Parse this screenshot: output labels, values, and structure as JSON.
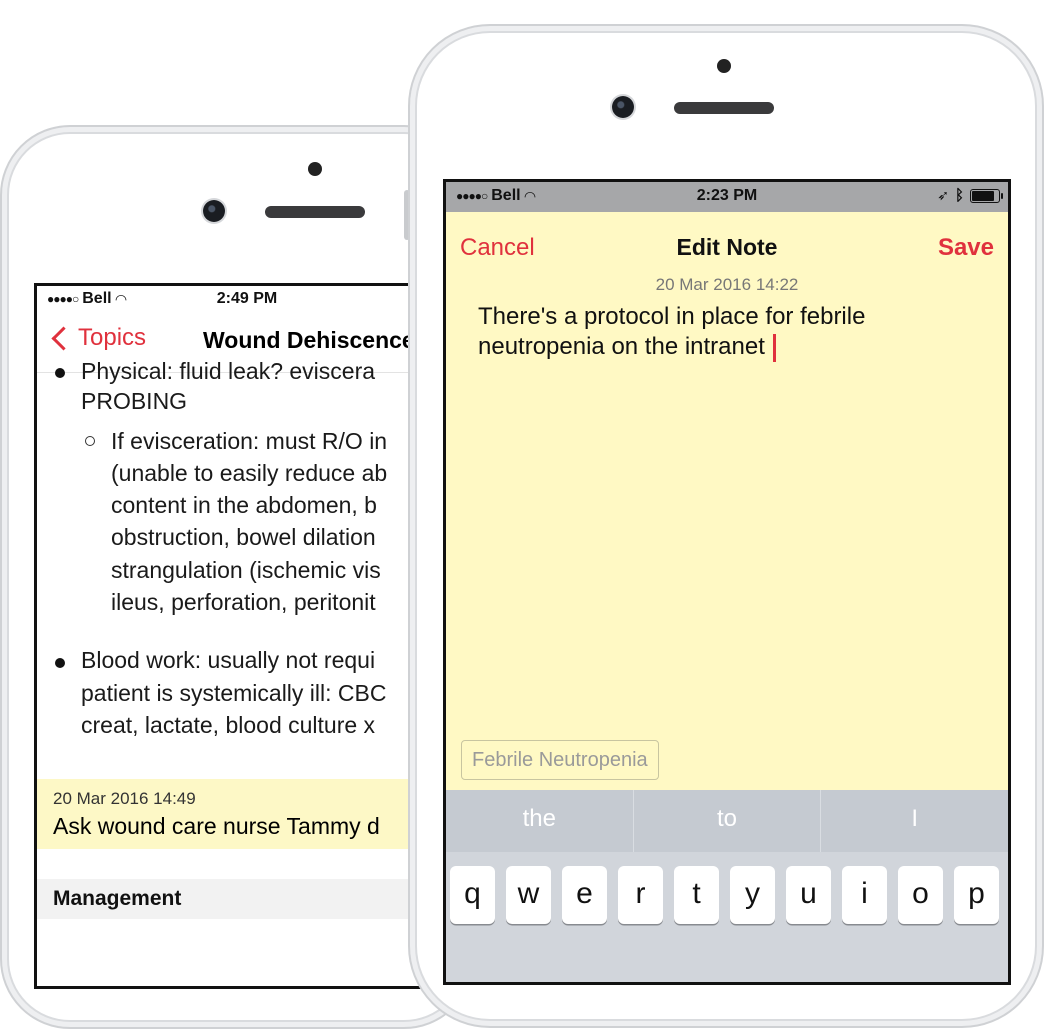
{
  "back_phone": {
    "status": {
      "carrier": "Bell",
      "time": "2:49 PM"
    },
    "nav": {
      "back_label": "Topics",
      "title": "Wound Dehiscence"
    },
    "content_lines": [
      "Physical: fluid leak? eviscera",
      "PROBING",
      "If evisceration: must R/O in",
      "(unable to easily reduce ab",
      "content in the abdomen, b",
      "obstruction, bowel dilation",
      "strangulation (ischemic vis",
      "ileus, perforation, peritonit",
      "Blood work: usually not requi",
      "patient is systemically ill: CBC",
      "creat, lactate, blood culture x"
    ],
    "note": {
      "date": "20 Mar 2016 14:49",
      "text": "Ask wound care nurse Tammy d"
    },
    "section": "Management"
  },
  "front_phone": {
    "status": {
      "carrier": "Bell",
      "time": "2:23 PM"
    },
    "nav": {
      "cancel": "Cancel",
      "title": "Edit Note",
      "save": "Save"
    },
    "note": {
      "date": "20 Mar 2016 14:22",
      "line1": "There's a protocol in place for febrile",
      "line2": "neutropenia on the intranet"
    },
    "tag": "Febrile Neutropenia",
    "keyboard": {
      "suggestions": [
        "the",
        "to",
        "I"
      ],
      "row1": [
        "q",
        "w",
        "e",
        "r",
        "t",
        "y",
        "u",
        "i",
        "o",
        "p"
      ]
    }
  },
  "colors": {
    "accent": "#e0313d",
    "note_bg": "#fff9c4"
  }
}
